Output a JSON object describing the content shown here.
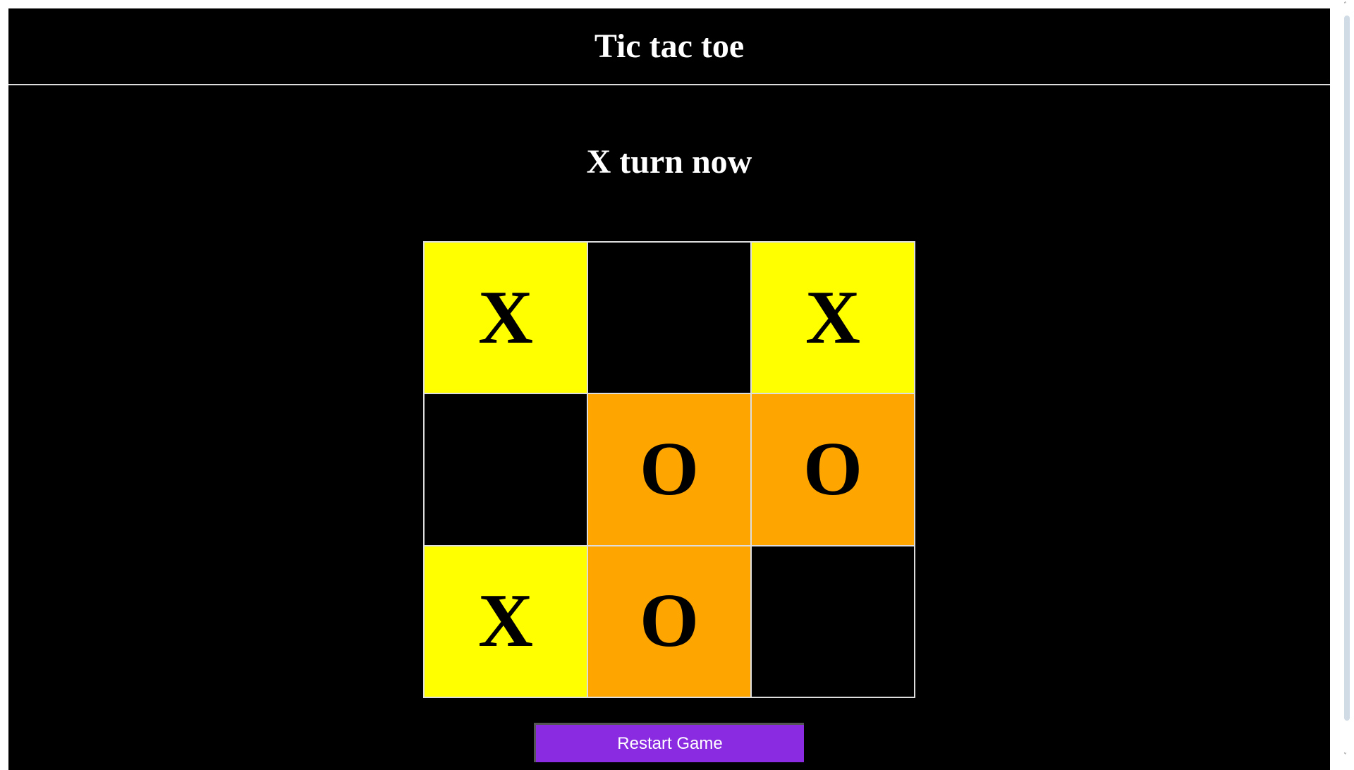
{
  "header": {
    "title": "Tic tac toe"
  },
  "status": "X turn now",
  "board": [
    "X",
    "",
    "X",
    "",
    "O",
    "O",
    "X",
    "O",
    ""
  ],
  "colors": {
    "X": "#ffff00",
    "O": "#ffa500",
    "empty": "#000000",
    "button": "#8a2be2"
  },
  "restart_label": "Restart Game"
}
